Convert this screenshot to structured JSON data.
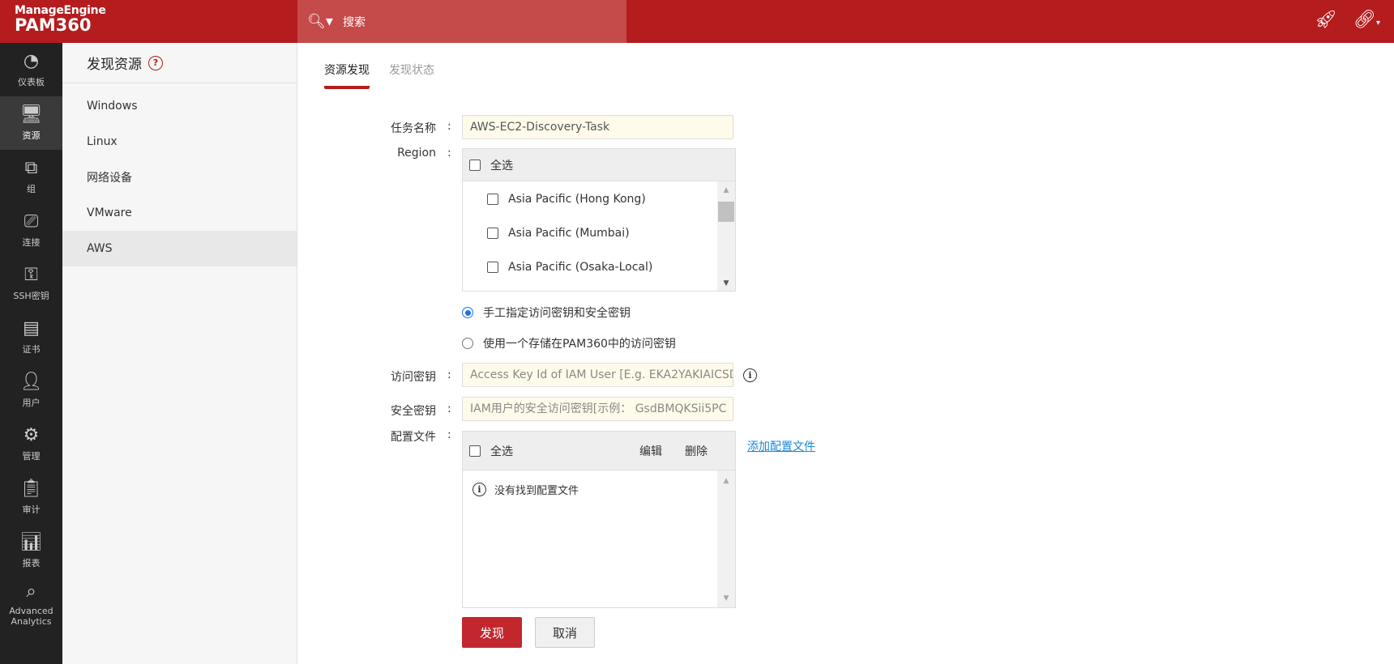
{
  "header": {
    "brand": "ManageEngine",
    "product": "PAM360",
    "search_placeholder": "搜索"
  },
  "nav": [
    {
      "label": "仪表板",
      "icon": "dashboard-icon"
    },
    {
      "label": "资源",
      "icon": "monitor-icon"
    },
    {
      "label": "组",
      "icon": "group-icon"
    },
    {
      "label": "连接",
      "icon": "connection-icon"
    },
    {
      "label": "SSH密钥",
      "icon": "ssh-key-icon"
    },
    {
      "label": "证书",
      "icon": "certificate-icon"
    },
    {
      "label": "用户",
      "icon": "user-icon"
    },
    {
      "label": "管理",
      "icon": "gear-icon"
    },
    {
      "label": "审计",
      "icon": "audit-icon"
    },
    {
      "label": "报表",
      "icon": "reports-icon"
    },
    {
      "label": "Advanced Analytics",
      "icon": "analytics-icon"
    }
  ],
  "sidebar": {
    "title": "发现资源",
    "items": [
      "Windows",
      "Linux",
      "网络设备",
      "VMware",
      "AWS"
    ]
  },
  "tabs": [
    "资源发现",
    "发现状态"
  ],
  "form": {
    "task_label": "任务名称",
    "task_value": "AWS-EC2-Discovery-Task",
    "region_label": "Region",
    "select_all": "全选",
    "regions": [
      "Asia Pacific (Hong Kong)",
      "Asia Pacific (Mumbai)",
      "Asia Pacific (Osaka-Local)"
    ],
    "radio_manual": "手工指定访问密钥和安全密钥",
    "radio_stored": "使用一个存储在PAM360中的访问密钥",
    "access_label": "访问密钥",
    "access_placeholder": "Access Key Id of IAM User [E.g. EKA2YAKIAICSDI",
    "secret_label": "安全密钥",
    "secret_placeholder": "IAM用户的安全访问密钥[示例：  GsdBMQKSii5PC",
    "config_label": "配置文件",
    "edit": "编辑",
    "delete": "删除",
    "add_config": "添加配置文件",
    "no_config": "没有找到配置文件",
    "colon": ":",
    "discover": "发现",
    "cancel": "取消"
  }
}
